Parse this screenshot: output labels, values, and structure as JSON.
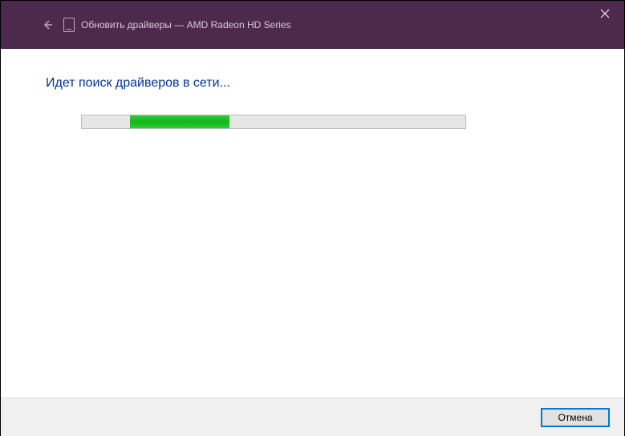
{
  "titlebar": {
    "title": "Обновить драйверы — AMD Radeon HD       Series"
  },
  "content": {
    "heading": "Идет поиск драйверов в сети..."
  },
  "footer": {
    "cancel_label": "Отмена"
  }
}
